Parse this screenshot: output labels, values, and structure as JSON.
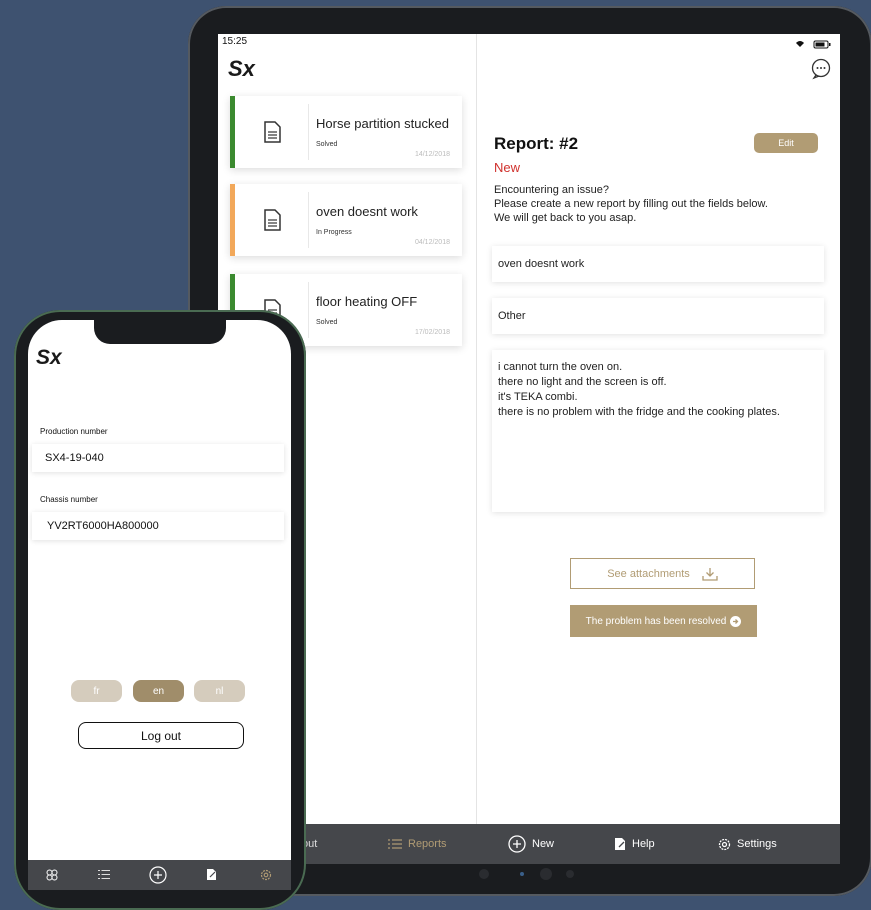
{
  "tablet": {
    "status_time": "15:25",
    "logo": "Sx",
    "reports": [
      {
        "title": "Horse partition stucked",
        "status": "Solved",
        "date": "14/12/2018",
        "color": "#3b8a2f"
      },
      {
        "title": "oven doesnt work",
        "status": "In Progress",
        "date": "04/12/2018",
        "color": "#f2a85a"
      },
      {
        "title": "floor heating OFF",
        "status": "Solved",
        "date": "17/02/2018",
        "color": "#3b8a2f"
      }
    ],
    "detail": {
      "title": "Report: #2",
      "edit_label": "Edit",
      "state": "New",
      "intro_line1": "Encountering an issue?",
      "intro_line2": "Please create a new report by filling out the fields below.",
      "intro_line3": "We will get back to you asap.",
      "subject": "oven doesnt work",
      "category": "Other",
      "description_lines": [
        "i cannot turn the oven on.",
        "there no light and the screen is off.",
        "it's TEKA combi.",
        "there is no problem with the fridge and the cooking plates."
      ],
      "attachments_label": "See attachments",
      "resolved_label": "The problem has been resolved"
    },
    "tabs": {
      "about": "out",
      "reports": "Reports",
      "new": "New",
      "help": "Help",
      "settings": "Settings"
    }
  },
  "phone": {
    "logo": "Sx",
    "production_label": "Production number",
    "production_value": "SX4-19-040",
    "chassis_label": "Chassis number",
    "chassis_value": "YV2RT6000HA800000",
    "languages": [
      "fr",
      "en",
      "nl"
    ],
    "selected_language": "en",
    "logout_label": "Log out"
  },
  "colors": {
    "accent": "#b19c74",
    "accent_light": "#d5ccbd",
    "new_red": "#d0312d",
    "tabbar": "#45474b",
    "background": "#3e5270"
  }
}
